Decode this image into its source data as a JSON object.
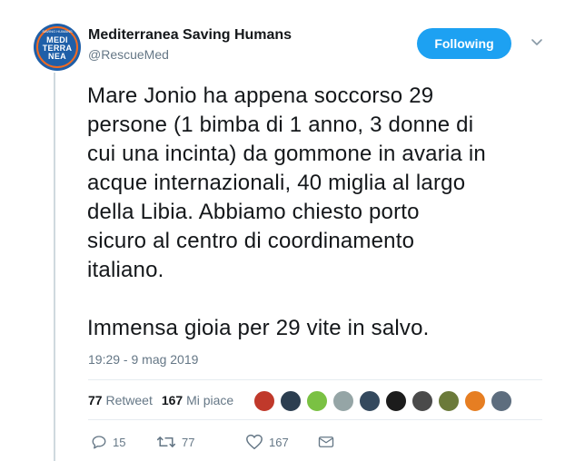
{
  "account": {
    "name": "Mediterranea Saving Humans",
    "handle": "@RescueMed",
    "avatar_text": "MEDI\nTERRA\nNEA",
    "avatar_arc_text": "SAVING HUMANS"
  },
  "follow_button": {
    "label": "Following"
  },
  "tweet": {
    "text": "Mare Jonio ha appena soccorso 29\npersone (1 bimba di 1 anno, 3 donne di\ncui una incinta) da gommone in avaria in\nacque internazionali, 40 miglia al largo\ndella Libia. Abbiamo chiesto porto\nsicuro al centro di coordinamento\nitaliano.\n\nImmensa gioia per 29 vite in salvo.",
    "timestamp": "19:29 - 9 mag 2019"
  },
  "stats": {
    "retweet_count": "77",
    "retweet_label": "Retweet",
    "like_count": "167",
    "like_label": "Mi piace"
  },
  "liker_avatars": [
    {
      "name": "liker-avatar-1",
      "color": "#c0392b"
    },
    {
      "name": "liker-avatar-2",
      "color": "#2c3e50"
    },
    {
      "name": "liker-avatar-3",
      "color": "#7ac143"
    },
    {
      "name": "liker-avatar-4",
      "color": "#95a5a6"
    },
    {
      "name": "liker-avatar-5",
      "color": "#34495e"
    },
    {
      "name": "liker-avatar-6",
      "color": "#1c1c1c"
    },
    {
      "name": "liker-avatar-7",
      "color": "#4a4a4a"
    },
    {
      "name": "liker-avatar-8",
      "color": "#6b7a3a"
    },
    {
      "name": "liker-avatar-9",
      "color": "#e67e22"
    },
    {
      "name": "liker-avatar-10",
      "color": "#5d6d7e"
    }
  ],
  "actions": {
    "reply_count": "15",
    "retweet_count": "77",
    "like_count": "167"
  },
  "colors": {
    "accent": "#1da1f2",
    "text": "#14171a",
    "muted": "#657786",
    "divider": "#e6ecf0"
  }
}
